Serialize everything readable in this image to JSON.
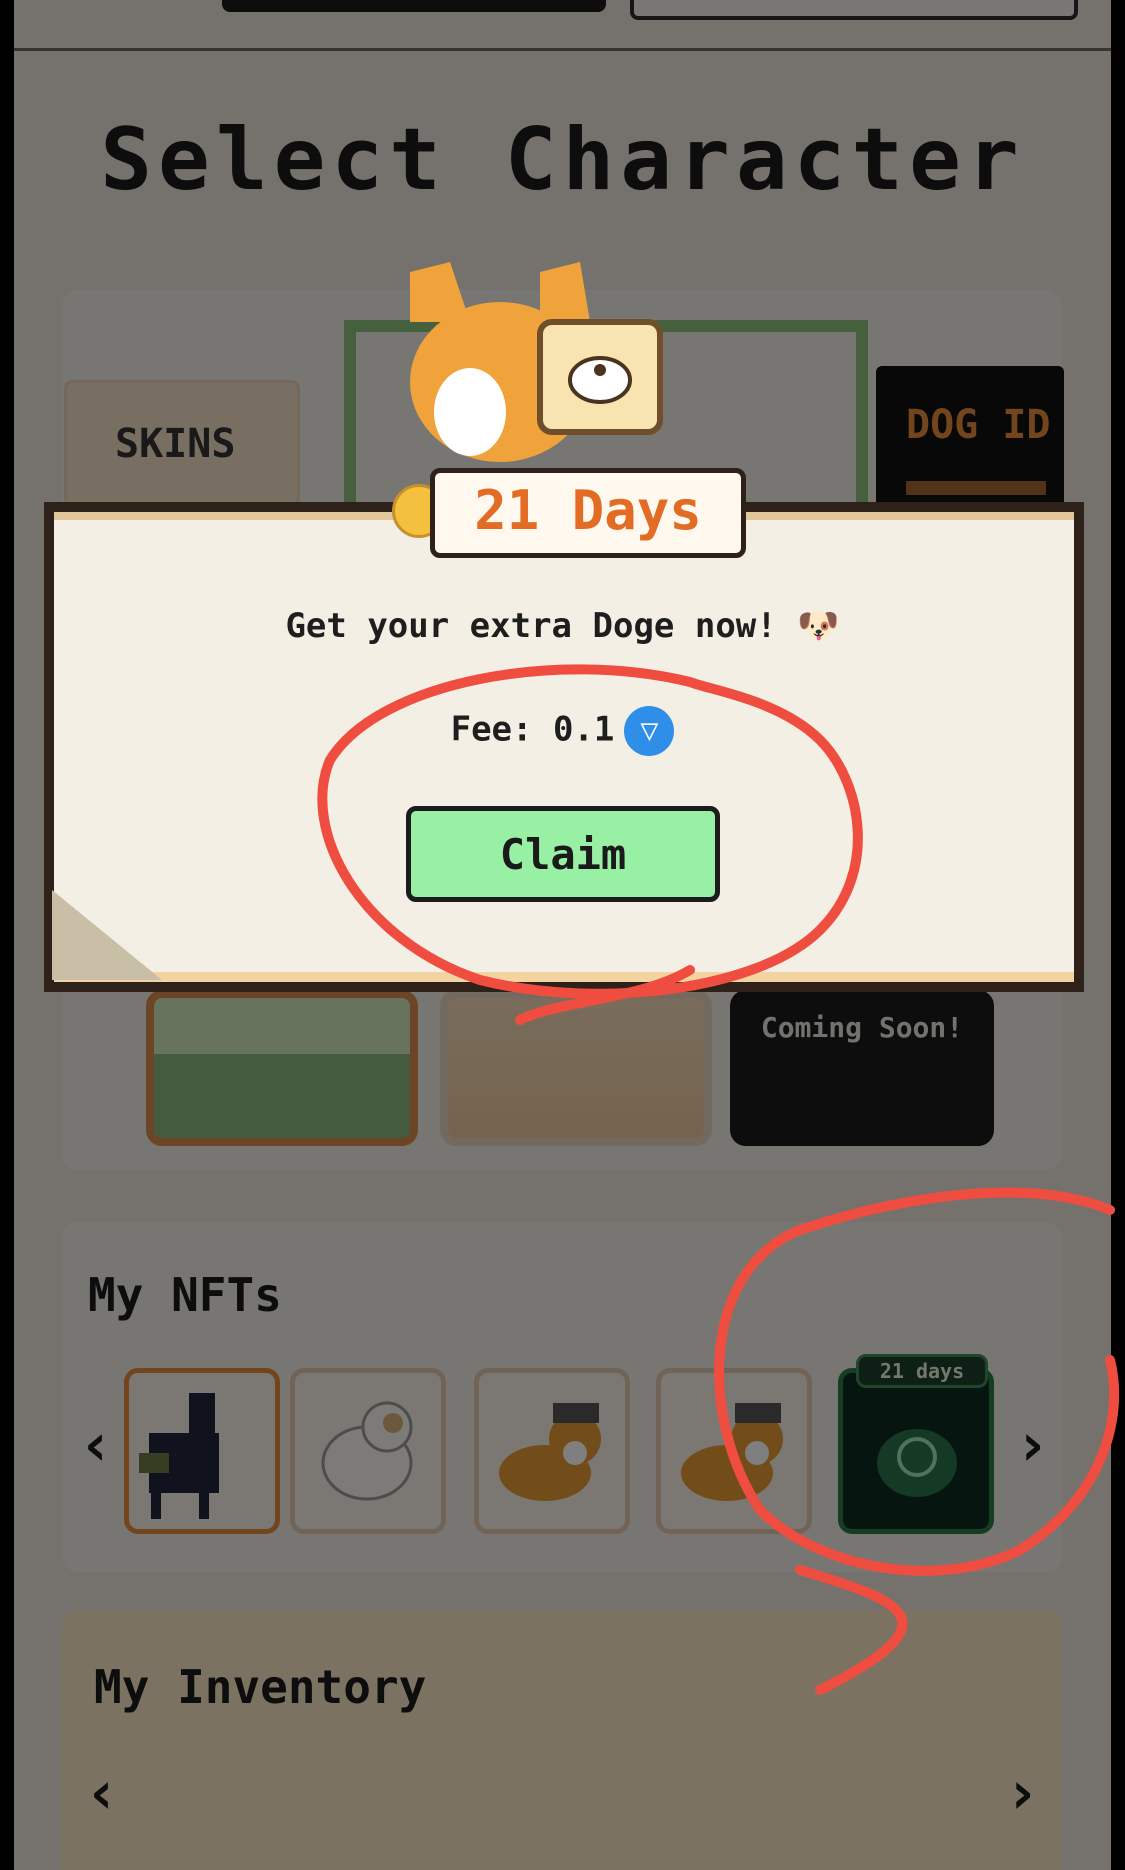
{
  "header": {
    "title": "Select Character"
  },
  "character_panel": {
    "skins_label": "SKINS",
    "dog_id_label": "DOG ID",
    "coming_soon": "Coming Soon!"
  },
  "nfts": {
    "title": "My NFTs",
    "prev_icon": "‹",
    "next_icon": "›",
    "badge": "21 days"
  },
  "inventory": {
    "title": "My Inventory",
    "prev_icon": "‹",
    "next_icon": "›"
  },
  "modal": {
    "days_label": "21 Days",
    "message": "Get your extra Doge now! 🐶",
    "fee_label": "Fee: 0.1",
    "currency_icon": "ton-icon",
    "claim_label": "Claim"
  },
  "colors": {
    "accent_orange": "#e26c24",
    "claim_green": "#98f0a4",
    "ton_blue": "#2f8ee8",
    "annotation_red": "#ef4d3f"
  }
}
